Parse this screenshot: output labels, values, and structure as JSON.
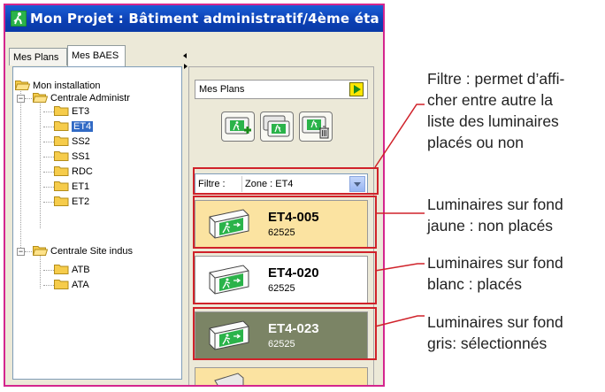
{
  "window": {
    "title": "Mon Projet : Bâtiment administratif/4ème éta"
  },
  "tabs": [
    {
      "label": "Mes Plans",
      "active": false
    },
    {
      "label": "Mes BAES",
      "active": true
    }
  ],
  "tree": {
    "root": "Mon installation",
    "groups": [
      {
        "label": "Centrale Administr",
        "items": [
          "ET3",
          "ET4",
          "SS2",
          "SS1",
          "RDC",
          "ET1",
          "ET2"
        ],
        "selected": "ET4"
      },
      {
        "label": "Centrale Site indus",
        "items": [
          "ATB",
          "ATA"
        ]
      }
    ]
  },
  "right_panel": {
    "header": "Mes Plans",
    "filter_label": "Filtre :",
    "filter_value": "Zone : ET4"
  },
  "luminaires": [
    {
      "name": "ET4-005",
      "code": "62525",
      "state": "non placé",
      "bg": "#fbe3a1",
      "text_color": "#000000"
    },
    {
      "name": "ET4-020",
      "code": "62525",
      "state": "placé",
      "bg": "#ffffff",
      "text_color": "#000000"
    },
    {
      "name": "ET4-023",
      "code": "62525",
      "state": "sélectionné",
      "bg": "#7b8465",
      "text_color": "#ffffff"
    }
  ],
  "annotations": [
    {
      "lines": [
        "Filtre : permet d’affi-",
        "cher entre autre la",
        "liste des luminaires",
        "placés ou non"
      ]
    },
    {
      "lines": [
        "Luminaires sur fond",
        "jaune : non placés"
      ]
    },
    {
      "lines": [
        "Luminaires sur fond",
        "blanc : placés"
      ]
    },
    {
      "lines": [
        "Luminaires sur fond",
        "gris: sélectionnés"
      ]
    }
  ],
  "colors": {
    "frame": "#d4268e",
    "highlight": "#d0222a",
    "selection": "#316ac5"
  }
}
